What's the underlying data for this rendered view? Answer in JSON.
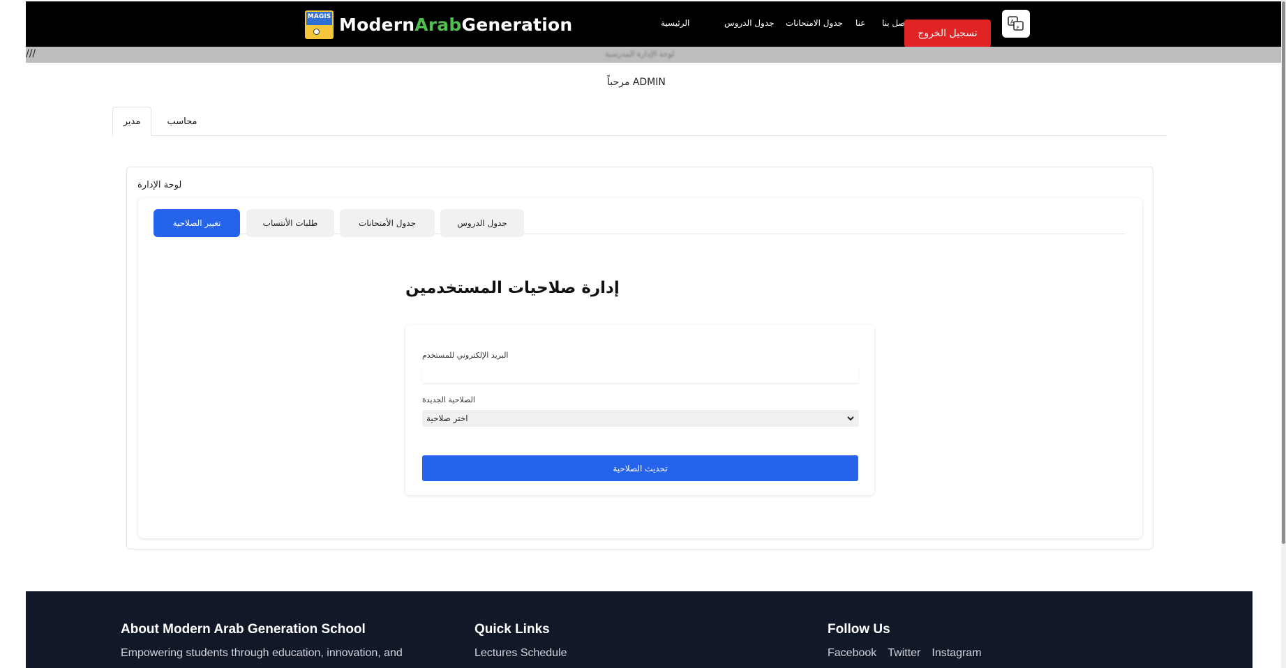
{
  "navbar": {
    "brand": {
      "part1": "Modern",
      "part2": "Arab",
      "part3": "Generation",
      "logo_text": "MAGIS"
    },
    "links": [
      "الرئيسية",
      "جدول الدروس",
      "جدول الامتحانات",
      "عنا",
      "اتصل بنا"
    ],
    "logout_label": "تسجيل الخروج",
    "translate_icon": "translate-icon",
    "colors": {
      "background": "#000000",
      "brand_accent": "#4fbf4f",
      "logout": "#e02424"
    }
  },
  "strip": {
    "left_text": "///",
    "center_text": "لوحة الإدارة المدرسية"
  },
  "welcome": "مرحباً ADMIN",
  "role_tabs": [
    {
      "label": "مدير",
      "active": true
    },
    {
      "label": "محاسب",
      "active": false
    }
  ],
  "panel": {
    "title": "لوحة الإدارة",
    "sub_tabs": [
      {
        "label": "جدول الدروس",
        "active": false
      },
      {
        "label": "جدول الأمتحانات",
        "active": false
      },
      {
        "label": "طلبات الأنتساب",
        "active": false
      },
      {
        "label": "تغيير الصلاحية",
        "active": true
      }
    ],
    "heading": "إدارة صلاحيات المستخدمين",
    "form": {
      "email_label": "البريد الإلكتروني للمستخدم",
      "email_value": "",
      "role_label": "الصلاحية الجديدة",
      "role_selected": "اختر صلاحية",
      "submit_label": "تحديث الصلاحية",
      "accent": "#2563eb"
    }
  },
  "footer": {
    "about_heading": "About Modern Arab Generation School",
    "about_text": "Empowering students through education, innovation, and",
    "quick_heading": "Quick Links",
    "quick_first": "Lectures Schedule",
    "follow_heading": "Follow Us",
    "social": [
      "Facebook",
      "Twitter",
      "Instagram"
    ]
  }
}
